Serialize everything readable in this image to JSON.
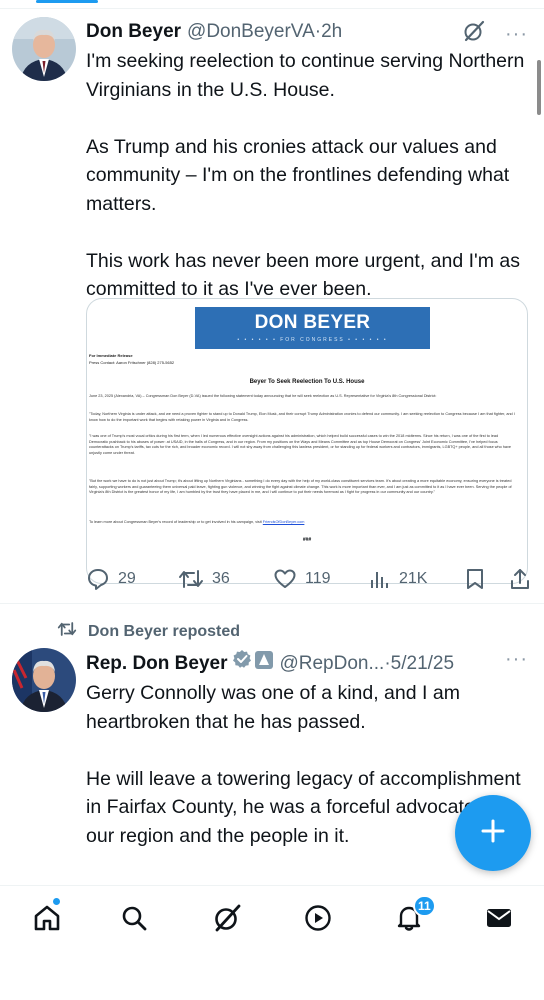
{
  "tweet1": {
    "name": "Don Beyer",
    "handle": "@DonBeyerVA",
    "separator": "·",
    "time": "2h",
    "paragraphs": [
      "I'm seeking reelection to continue serving Northern Virginians in the U.S. House.",
      "As Trump and his cronies attack our values and community – I'm on the frontlines defending what matters.",
      "This work has never been more urgent, and I'm as committed to it as I've ever been."
    ],
    "media": {
      "banner_title": "DON BEYER",
      "banner_sub": "• • • • • • FOR CONGRESS • • • • • •",
      "release_label": "For Immediate Release",
      "press_contact": "Press Contact: Aaron Fritschner (828) 275-5652",
      "release_title": "Beyer To Seek Reelection To U.S. House",
      "p1": "June 23, 2025 (Alexandria, VA) – Congressman Don Beyer (D-VA) issued the following statement today announcing that he will seek reelection as U.S. Representative for Virginia's 8th Congressional District:",
      "p2": "\"Today, Northern Virginia is under attack, and we need a proven fighter to stand up to Donald Trump, Elon Musk, and their corrupt Trump Administration cronies to defend our community. I am seeking reelection to Congress because I am that fighter, and I know how to do the important work that begins with retaking power in Virginia and in Congress.",
      "p3": "\"I was one of Trump's most vocal critics during his first term, when I led numerous effective oversight actions against his administration, which helped build successful cases to win the 2018 midterms. Since his return, I was one of the first to lead Democratic pushback to his abuses of power: at USAID, in the halls of Congress, and in our region. From my positions on the Ways and Means Committee and as top House Democrat on Congress' Joint Economic Committee, I've helped focus counterattacks on Trump's tariffs, tax cuts for the rich, and broader economic record. I will not shy away from challenging this lawless president, or for standing up for federal workers and contractors, immigrants, LGBTQ+ people, and all those who have unjustly come under threat.",
      "p4": "\"But the work we have to do is not just about Trump; it's about lifting up Northern Virginians - something I do every day with the help of my world-class constituent services team. It's about creating a more equitable economy, ensuring everyone is treated fairly, supporting workers and guaranteeing them universal paid leave, fighting gun violence, and winning the fight against climate change. This work is more important than ever, and I am just as committed to it as I have ever been. Serving the people of Virginia's 8th District is the greatest honor of my life, I am humbled by the trust they have placed in me, and I will continue to put their needs foremost as I fight for progress in our community and our country.\"",
      "p5_text": "To learn more about Congressman Beyer's record of leadership or to get involved in his campaign, visit ",
      "p5_link": "FriendsOfDonBeyer.com",
      "hashes": "###"
    },
    "actions": {
      "replies": "29",
      "reposts": "36",
      "likes": "119",
      "views": "21K"
    }
  },
  "repost_label": "Don Beyer reposted",
  "tweet2": {
    "name": "Rep. Don Beyer",
    "handle": "@RepDon...",
    "separator": "·",
    "time": "5/21/25",
    "paragraphs": [
      "Gerry Connolly was one of a kind, and I am heartbroken that he has passed.",
      "He will leave a towering legacy of accomplishment in Fairfax County, he was a forceful advocate for our region and the people in it."
    ]
  },
  "tabbar": {
    "notifications_badge": "11"
  },
  "colors": {
    "accent": "#1d9bf0",
    "secondary_text": "#536471",
    "banner_blue": "#2d6fb5"
  },
  "icons": [
    "grok-icon",
    "more-icon",
    "reply-icon",
    "repost-icon",
    "like-icon",
    "views-icon",
    "bookmark-icon",
    "share-icon",
    "home-icon",
    "search-icon",
    "video-icon",
    "notifications-icon",
    "messages-icon",
    "compose-icon"
  ]
}
